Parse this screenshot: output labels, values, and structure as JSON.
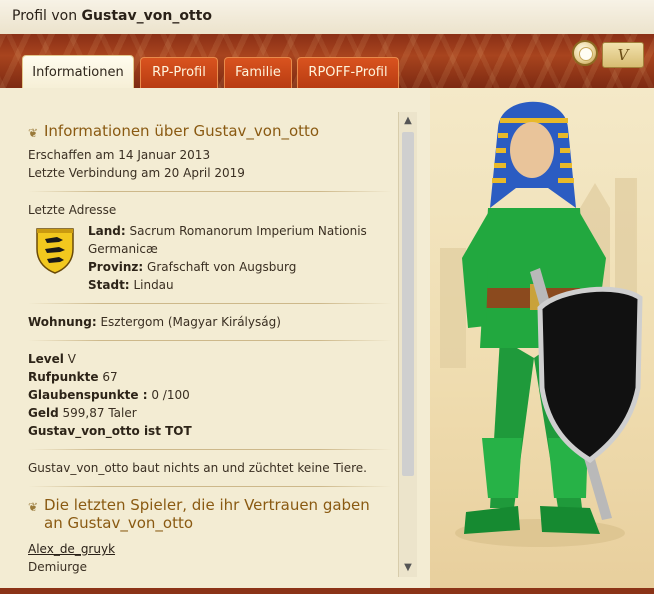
{
  "window": {
    "title_prefix": "Profil von",
    "title_name": "Gustav_von_otto"
  },
  "header": {
    "level_badge": "V",
    "medal_icon": "medal-icon"
  },
  "tabs": [
    {
      "label": "Informationen",
      "active": true
    },
    {
      "label": "RP-Profil",
      "active": false
    },
    {
      "label": "Familie",
      "active": false
    },
    {
      "label": "RPOFF-Profil",
      "active": false
    }
  ],
  "info": {
    "heading": "Informationen über Gustav_von_otto",
    "created": "Erschaffen am 14 Januar 2013",
    "last_login": "Letzte Verbindung am 20 April 2019",
    "address_title": "Letzte Adresse",
    "land_label": "Land:",
    "land_value": "Sacrum Romanorum Imperium Nationis Germanicæ",
    "province_label": "Provinz:",
    "province_value": "Grafschaft von Augsburg",
    "city_label": "Stadt:",
    "city_value": "Lindau",
    "home_label": "Wohnung:",
    "home_value": "Esztergom (Magyar Királyság)",
    "level_label": "Level",
    "level_value": "V",
    "reputation_label": "Rufpunkte",
    "reputation_value": "67",
    "faith_label": "Glaubenspunkte :",
    "faith_value": "0 /100",
    "money_label": "Geld",
    "money_value": "599,87 Taler",
    "status": "Gustav_von_otto ist TOT",
    "activity": "Gustav_von_otto baut nichts an und züchtet keine Tiere."
  },
  "trust": {
    "heading": "Die letzten Spieler, die ihr Vertrauen gaben an Gustav_von_otto",
    "players": [
      {
        "name": "Alex_de_gruyk",
        "rank": "Demiurge"
      }
    ]
  },
  "colors": {
    "band": "#a8441e",
    "tab": "#c8461a",
    "heading": "#8a5a12",
    "background": "#f3ecd3"
  }
}
